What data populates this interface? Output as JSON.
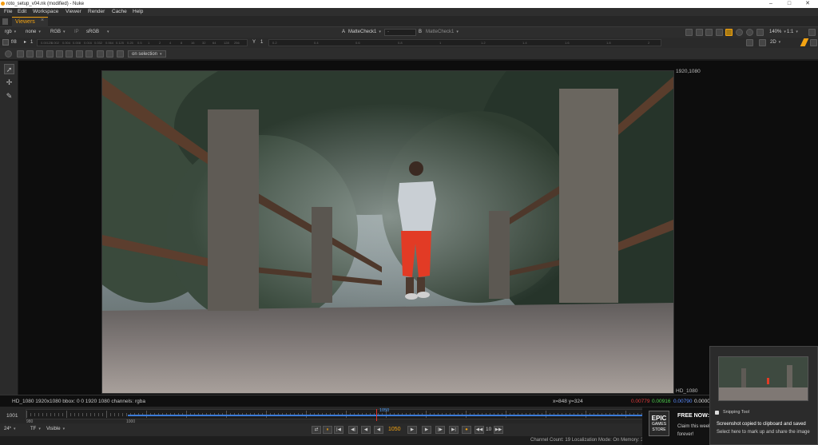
{
  "window": {
    "title": "roto_setup_v04.nk (modified) - Nuke",
    "minimize_icon": "minimize-icon",
    "maximize_icon": "maximize-icon",
    "close_icon": "close-icon"
  },
  "menu": [
    "File",
    "Edit",
    "Workspace",
    "Viewer",
    "Render",
    "Cache",
    "Help"
  ],
  "tabs": {
    "active": "Viewers",
    "close": "×"
  },
  "viewer_controls": {
    "channels": "rgb",
    "alpha_channel": "none",
    "display_channels": "RGB",
    "ip_label": "IP",
    "colorspace": "sRGB",
    "input_a_label": "A",
    "input_a": "MatteCheck1",
    "input_a_op": "-",
    "input_b_label": "B",
    "input_b": "MatteCheck1",
    "zoom": "140%",
    "proxy": "1:1",
    "view_mode": "2D"
  },
  "row2": {
    "fstop": "f/8",
    "gain_arrow": "▸",
    "gain": "1",
    "gamma_label": "Y",
    "gamma": "1",
    "gain_ticks": [
      "0.00125",
      "0.002",
      "0.004",
      "0.008",
      "0.016",
      "0.032",
      "0.064",
      "0.125",
      "0.25",
      "0.5",
      "1",
      "2",
      "4",
      "8",
      "16",
      "32",
      "64",
      "128",
      "256"
    ],
    "gamma_ticks": [
      "0.2",
      "0.4",
      "0.6",
      "0.8",
      "1",
      "1.2",
      "1.4",
      "1.6",
      "1.8",
      "2"
    ]
  },
  "row3": {
    "lifetime": "on selection"
  },
  "viewer": {
    "format_top_right": "1920,1080",
    "format_bottom_right": "HD_1080"
  },
  "info_bar": {
    "format_info": "HD_1080 1920x1080  bbox: 0 0 1920 1080 channels: rgba",
    "coords": "x=848 y=324",
    "r": "0.00779",
    "g": "0.00916",
    "b": "0.00790",
    "a": "0.0000"
  },
  "timeline": {
    "start_frame": "1001",
    "label_980": "980",
    "label_1000": "1000",
    "label_1050": "1050",
    "current_frame_marker": "1050",
    "fps": "24*",
    "tf": "TF",
    "visible": "Visible",
    "frame_field": "1050",
    "step": "10",
    "icons": [
      "first-frame-icon",
      "prev-key-icon",
      "prev-frame-icon",
      "play-back-icon",
      "play-icon",
      "next-frame-icon",
      "next-key-icon",
      "last-frame-icon"
    ]
  },
  "status": "Channel Count: 19  Localization Mode: On  Memory: 3.1 GB (4.8%)  CPU: 0.0%  Disk: 4.0 MB/s  Network: 0.0 MB/s",
  "epic": {
    "logo_line1": "EPIC",
    "logo_line2": "GAMES",
    "logo_line3": "STORE",
    "headline": "FREE NOW: S",
    "line1": "Claim this week",
    "line2": "forever!"
  },
  "notification": {
    "app": "Snipping Tool",
    "title": "Screenshot copied to clipboard and saved",
    "body": "Select here to mark up and share the image"
  },
  "colors": {
    "accent": "#f3a312",
    "red_channel": "#e03c3c",
    "green_channel": "#4ccf4c",
    "blue_channel": "#5a8cff",
    "playhead": "#e0302a",
    "timeline_blue": "#3b7bd8"
  }
}
